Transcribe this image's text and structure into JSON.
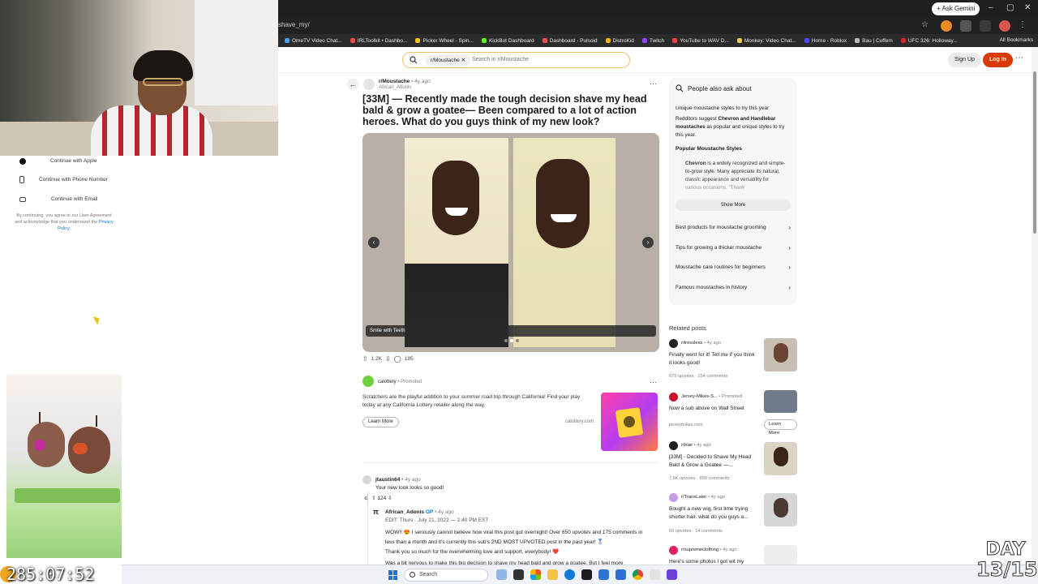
{
  "browser": {
    "gemini_button": "+ Ask Gemini",
    "url_fragment": "shave_my/",
    "bookmarks": [
      {
        "label": "OmeTV Video Chat...",
        "color": "#3ea1f0"
      },
      {
        "label": "IRLToolkit • Dashbo...",
        "color": "#e94b4b"
      },
      {
        "label": "Picker Wheel - Spin...",
        "color": "#f0c419"
      },
      {
        "label": "KickBot Dashboard",
        "color": "#53fc18"
      },
      {
        "label": "Dashboard - Pulsoid",
        "color": "#ff4d4d"
      },
      {
        "label": "DistroKid",
        "color": "#f5b400"
      },
      {
        "label": "Twitch",
        "color": "#9146ff"
      },
      {
        "label": "YouTube to WAV D...",
        "color": "#ff3d3d"
      },
      {
        "label": "Monkey: Video Chat...",
        "color": "#f2c84b"
      },
      {
        "label": "Home - Roblox",
        "color": "#4a4aff"
      },
      {
        "label": "Bau | Cuffem",
        "color": "#bbbbbb"
      },
      {
        "label": "UFC 326: Holloway...",
        "color": "#e21d2d"
      }
    ],
    "all_bookmarks": "All Bookmarks"
  },
  "reddit_header": {
    "search_chip": "r/Moustache",
    "search_placeholder": "Search in r/Moustache",
    "signup": "Sign Up",
    "login": "Log In"
  },
  "signin_panel": {
    "buttons": [
      {
        "label": "Continue with Apple",
        "icon": "apple-icon"
      },
      {
        "label": "Continue with Phone Number",
        "icon": "phone-icon"
      },
      {
        "label": "Continue with Email",
        "icon": "email-icon"
      }
    ],
    "legal_text": "By continuing, you agree to our User Agreement and acknowledge that you understand the",
    "privacy_link": "Privacy Policy."
  },
  "stream": {
    "timer": "285:07:52",
    "day_line1": "DAY",
    "day_line2": "13/15"
  },
  "post": {
    "subreddit": "r/Moustache",
    "time": "• 4y ago",
    "author": "African_Adonis",
    "title": "[33M] — Recently made the tough decision shave my head bald & grow a goatee— Been compared to a lot of action heroes. What do you guys think of my new look?",
    "caption": "Smile with Teeth",
    "upvotes": "1.2K",
    "comments": "185"
  },
  "ad": {
    "advertiser": "calottery",
    "promoted": "• Promoted",
    "copy": "Scratchers are the playful addition to your summer road trip through California! Find your play today at any California Lottery retailer along the way.",
    "learn_more": "Learn More",
    "domain": "calottery.com"
  },
  "comments": [
    {
      "user": "jtaustin64",
      "time": "• 4y ago",
      "text": "Your new look looks so good!",
      "votes": "124"
    },
    {
      "user": "African_Adonis",
      "op": "OP",
      "time": "• 4y ago",
      "edit": "EDIT: Thurs · July 21, 2022 — 2:40 PM EST",
      "p1": "WOW!! 😍 I seriously cannot believe how viral this post got overnight! Over 650 upvotes and 175 comments in less than a month and it's currently this sub's 2ND MOST UPVOTED post in the past year! 🥈",
      "p2": "Thank you so much for the overwhelming love and support, everybody! ❤️",
      "p3": "Was a bit nervous to make this big decision to shave my head bald and grow a goatee. But I feel more"
    }
  ],
  "people_also_ask": {
    "heading": "People also ask about",
    "question": "Unique moustache styles to try this year",
    "answer_pre": "Redditors suggest ",
    "answer_bold": "Chevron and Handlebar moustaches",
    "answer_post": " as popular and unique styles to try this year.",
    "subheading": "Popular Moustache Styles",
    "bullet_bold": "Chevron",
    "bullet_text": " is a widely recognized and simple-to-grow style. Many appreciate its natural, classic appearance and versatility for various occasions. \"Thank",
    "show_more": "Show More",
    "related": [
      "Best products for moustache grooming",
      "Tips for growing a thicker moustache",
      "Moustache care routines for beginners",
      "Famous moustaches in history"
    ]
  },
  "related_posts": {
    "heading": "Related posts",
    "items": [
      {
        "sub": "r/tressless",
        "time": "• 4y ago",
        "title": "Finally went for it! Tell me if you think it looks good!",
        "stats": "675 upvotes  ·  154 comments"
      },
      {
        "sub": "Jersey-Mikes-S...",
        "time": "• Promoted",
        "title": "Now a sub above on Wall Street",
        "stats": "jerseymikes.com",
        "cta": "Learn More"
      },
      {
        "sub": "r/Hair",
        "time": "• 4y ago",
        "title": "[33M] - Decided to Shave My Head Bald & Grow a Goatee —...",
        "stats": "7.6K upvotes  ·  899 comments"
      },
      {
        "sub": "r/TransLater",
        "time": "• 4y ago",
        "title": "Bought a new wig, first time trying shorter hair. what do you guys a...",
        "stats": "60 upvotes  ·  14 comments"
      },
      {
        "sub": "r/supremeclothing",
        "time": "• 4y ago",
        "title": "Here's some photos I got wit my"
      }
    ]
  },
  "taskbar": {
    "search": "Search"
  }
}
